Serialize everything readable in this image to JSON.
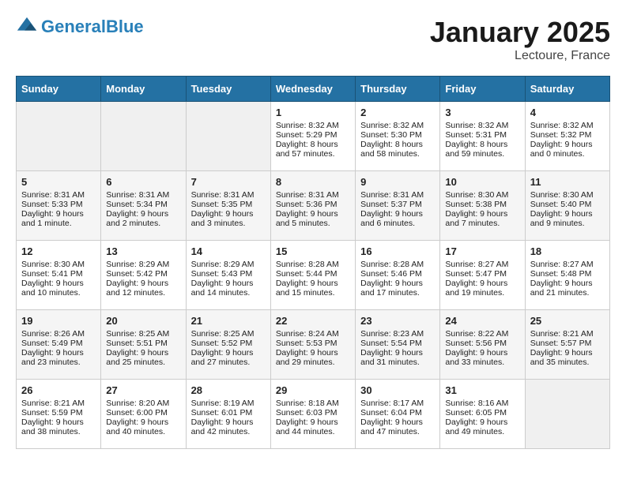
{
  "header": {
    "logo_line1": "General",
    "logo_line2": "Blue",
    "month": "January 2025",
    "location": "Lectoure, France"
  },
  "days_of_week": [
    "Sunday",
    "Monday",
    "Tuesday",
    "Wednesday",
    "Thursday",
    "Friday",
    "Saturday"
  ],
  "weeks": [
    [
      {
        "day": "",
        "content": ""
      },
      {
        "day": "",
        "content": ""
      },
      {
        "day": "",
        "content": ""
      },
      {
        "day": "1",
        "content": "Sunrise: 8:32 AM\nSunset: 5:29 PM\nDaylight: 8 hours and 57 minutes."
      },
      {
        "day": "2",
        "content": "Sunrise: 8:32 AM\nSunset: 5:30 PM\nDaylight: 8 hours and 58 minutes."
      },
      {
        "day": "3",
        "content": "Sunrise: 8:32 AM\nSunset: 5:31 PM\nDaylight: 8 hours and 59 minutes."
      },
      {
        "day": "4",
        "content": "Sunrise: 8:32 AM\nSunset: 5:32 PM\nDaylight: 9 hours and 0 minutes."
      }
    ],
    [
      {
        "day": "5",
        "content": "Sunrise: 8:31 AM\nSunset: 5:33 PM\nDaylight: 9 hours and 1 minute."
      },
      {
        "day": "6",
        "content": "Sunrise: 8:31 AM\nSunset: 5:34 PM\nDaylight: 9 hours and 2 minutes."
      },
      {
        "day": "7",
        "content": "Sunrise: 8:31 AM\nSunset: 5:35 PM\nDaylight: 9 hours and 3 minutes."
      },
      {
        "day": "8",
        "content": "Sunrise: 8:31 AM\nSunset: 5:36 PM\nDaylight: 9 hours and 5 minutes."
      },
      {
        "day": "9",
        "content": "Sunrise: 8:31 AM\nSunset: 5:37 PM\nDaylight: 9 hours and 6 minutes."
      },
      {
        "day": "10",
        "content": "Sunrise: 8:30 AM\nSunset: 5:38 PM\nDaylight: 9 hours and 7 minutes."
      },
      {
        "day": "11",
        "content": "Sunrise: 8:30 AM\nSunset: 5:40 PM\nDaylight: 9 hours and 9 minutes."
      }
    ],
    [
      {
        "day": "12",
        "content": "Sunrise: 8:30 AM\nSunset: 5:41 PM\nDaylight: 9 hours and 10 minutes."
      },
      {
        "day": "13",
        "content": "Sunrise: 8:29 AM\nSunset: 5:42 PM\nDaylight: 9 hours and 12 minutes."
      },
      {
        "day": "14",
        "content": "Sunrise: 8:29 AM\nSunset: 5:43 PM\nDaylight: 9 hours and 14 minutes."
      },
      {
        "day": "15",
        "content": "Sunrise: 8:28 AM\nSunset: 5:44 PM\nDaylight: 9 hours and 15 minutes."
      },
      {
        "day": "16",
        "content": "Sunrise: 8:28 AM\nSunset: 5:46 PM\nDaylight: 9 hours and 17 minutes."
      },
      {
        "day": "17",
        "content": "Sunrise: 8:27 AM\nSunset: 5:47 PM\nDaylight: 9 hours and 19 minutes."
      },
      {
        "day": "18",
        "content": "Sunrise: 8:27 AM\nSunset: 5:48 PM\nDaylight: 9 hours and 21 minutes."
      }
    ],
    [
      {
        "day": "19",
        "content": "Sunrise: 8:26 AM\nSunset: 5:49 PM\nDaylight: 9 hours and 23 minutes."
      },
      {
        "day": "20",
        "content": "Sunrise: 8:25 AM\nSunset: 5:51 PM\nDaylight: 9 hours and 25 minutes."
      },
      {
        "day": "21",
        "content": "Sunrise: 8:25 AM\nSunset: 5:52 PM\nDaylight: 9 hours and 27 minutes."
      },
      {
        "day": "22",
        "content": "Sunrise: 8:24 AM\nSunset: 5:53 PM\nDaylight: 9 hours and 29 minutes."
      },
      {
        "day": "23",
        "content": "Sunrise: 8:23 AM\nSunset: 5:54 PM\nDaylight: 9 hours and 31 minutes."
      },
      {
        "day": "24",
        "content": "Sunrise: 8:22 AM\nSunset: 5:56 PM\nDaylight: 9 hours and 33 minutes."
      },
      {
        "day": "25",
        "content": "Sunrise: 8:21 AM\nSunset: 5:57 PM\nDaylight: 9 hours and 35 minutes."
      }
    ],
    [
      {
        "day": "26",
        "content": "Sunrise: 8:21 AM\nSunset: 5:59 PM\nDaylight: 9 hours and 38 minutes."
      },
      {
        "day": "27",
        "content": "Sunrise: 8:20 AM\nSunset: 6:00 PM\nDaylight: 9 hours and 40 minutes."
      },
      {
        "day": "28",
        "content": "Sunrise: 8:19 AM\nSunset: 6:01 PM\nDaylight: 9 hours and 42 minutes."
      },
      {
        "day": "29",
        "content": "Sunrise: 8:18 AM\nSunset: 6:03 PM\nDaylight: 9 hours and 44 minutes."
      },
      {
        "day": "30",
        "content": "Sunrise: 8:17 AM\nSunset: 6:04 PM\nDaylight: 9 hours and 47 minutes."
      },
      {
        "day": "31",
        "content": "Sunrise: 8:16 AM\nSunset: 6:05 PM\nDaylight: 9 hours and 49 minutes."
      },
      {
        "day": "",
        "content": ""
      }
    ]
  ]
}
